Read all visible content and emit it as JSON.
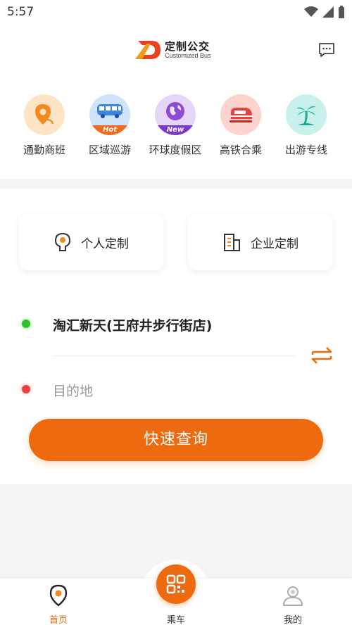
{
  "status_bar": {
    "time": "5:57"
  },
  "header": {
    "logo_cn": "定制公交",
    "logo_en": "Customized Bus",
    "message_icon": "chat-bubble-icon"
  },
  "categories": [
    {
      "label": "通勤商班",
      "icon": "location-pin-icon",
      "badge": ""
    },
    {
      "label": "区域巡游",
      "icon": "bus-icon",
      "badge": "Hot"
    },
    {
      "label": "环球度假区",
      "icon": "globe-icon",
      "badge": "New"
    },
    {
      "label": "高铁合乘",
      "icon": "train-icon",
      "badge": ""
    },
    {
      "label": "出游专线",
      "icon": "palm-tree-icon",
      "badge": ""
    }
  ],
  "cards": {
    "personal": {
      "label": "个人定制",
      "icon": "person-head-icon"
    },
    "enterprise": {
      "label": "企业定制",
      "icon": "building-icon"
    }
  },
  "route": {
    "origin": "淘汇新天(王府井步行街店)",
    "destination_placeholder": "目的地"
  },
  "search_button": "快速查询",
  "tabbar": {
    "home": "首页",
    "ride": "乘车",
    "mine": "我的"
  },
  "colors": {
    "accent": "#ee6a0f",
    "origin_dot": "#2dc22d",
    "destination_dot": "#e9423a"
  }
}
